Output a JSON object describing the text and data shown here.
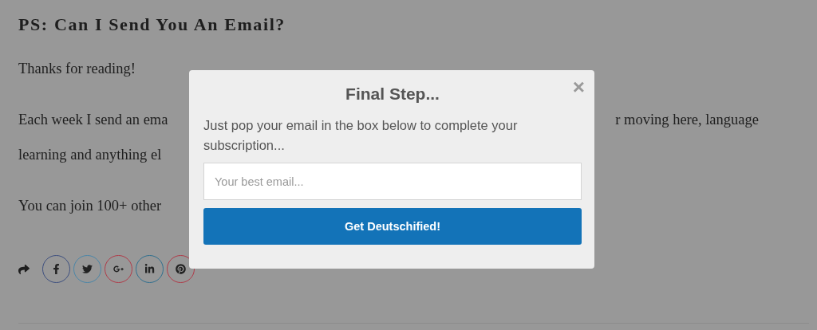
{
  "article": {
    "heading": "PS: Can I Send You An Email?",
    "paragraphs": [
      {
        "lines": [
          {
            "left": "Thanks for reading!"
          }
        ]
      },
      {
        "lines": [
          {
            "left": "Each week I send an ema",
            "right": "r moving here, language"
          },
          {
            "left": "learning and anything el"
          }
        ]
      },
      {
        "lines": [
          {
            "left": "You can join 100+ other"
          }
        ]
      }
    ]
  },
  "share": {
    "buttons": [
      {
        "kind": "facebook",
        "color": "#3d4f7f"
      },
      {
        "kind": "twitter",
        "color": "#4a86a8"
      },
      {
        "kind": "google-plus",
        "color": "#b03a48"
      },
      {
        "kind": "linkedin",
        "color": "#2f6f8f"
      },
      {
        "kind": "pinterest",
        "color": "#b03a48"
      }
    ]
  },
  "modal": {
    "title": "Final Step...",
    "close": "×",
    "text": "Just pop your email in the box below to complete your subscription...",
    "placeholder": "Your best email...",
    "button": "Get Deutschified!"
  }
}
